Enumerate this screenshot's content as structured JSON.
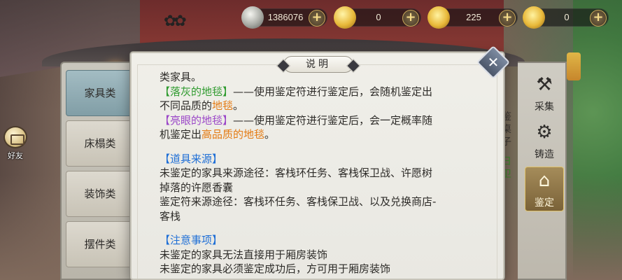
{
  "resources": [
    {
      "icon": "silver-coin-icon",
      "value": "1386076"
    },
    {
      "icon": "gold-coin-icon",
      "value": "0"
    },
    {
      "icon": "gold-ingot-icon",
      "value": "225"
    },
    {
      "icon": "gold-ingot-stack-icon",
      "value": "0"
    }
  ],
  "friends": {
    "label": "好友"
  },
  "categories": [
    {
      "label": "家具类",
      "active": true
    },
    {
      "label": "床榻类",
      "active": false
    },
    {
      "label": "装饰类",
      "active": false
    },
    {
      "label": "摆件类",
      "active": false
    }
  ],
  "actions": [
    {
      "label": "采集",
      "icon": "pickaxe-icon",
      "glyph": "⚒"
    },
    {
      "label": "铸造",
      "icon": "anvil-icon",
      "glyph": "⚙"
    },
    {
      "label": "鉴定",
      "icon": "appraise-icon",
      "glyph": "⌂"
    }
  ],
  "side_text": "鉴桌子",
  "side_text_green": "日卫",
  "scene": {
    "sign_text": "铸造"
  },
  "dialog": {
    "title": "说明",
    "close_symbol": "✕",
    "lines": [
      {
        "segments": [
          {
            "text": "类家具。",
            "color": "default"
          }
        ]
      },
      {
        "segments": [
          {
            "text": "【落灰的地毯】",
            "color": "green"
          },
          {
            "text": "——使用鉴定符进行鉴定后，会随机鉴定出",
            "color": "default"
          }
        ]
      },
      {
        "segments": [
          {
            "text": "不同品质的",
            "color": "default"
          },
          {
            "text": "地毯",
            "color": "orange"
          },
          {
            "text": "。",
            "color": "default"
          }
        ]
      },
      {
        "segments": [
          {
            "text": "【亮眼的地毯】",
            "color": "purple"
          },
          {
            "text": "——使用鉴定符进行鉴定后，会一定概率随",
            "color": "default"
          }
        ]
      },
      {
        "segments": [
          {
            "text": "机鉴定出",
            "color": "default"
          },
          {
            "text": "高品质的地毯",
            "color": "orange"
          },
          {
            "text": "。",
            "color": "default"
          }
        ]
      },
      {
        "gap": true
      },
      {
        "segments": [
          {
            "text": "【道具来源】",
            "color": "blue"
          }
        ]
      },
      {
        "segments": [
          {
            "text": "未鉴定的家具来源途径：客栈环任务、客栈保卫战、许愿树",
            "color": "default"
          }
        ]
      },
      {
        "segments": [
          {
            "text": "掉落的许愿香囊",
            "color": "default"
          }
        ]
      },
      {
        "segments": [
          {
            "text": "鉴定符来源途径：客栈环任务、客栈保卫战、以及兑换商店-",
            "color": "default"
          }
        ]
      },
      {
        "segments": [
          {
            "text": "客栈",
            "color": "default"
          }
        ]
      },
      {
        "gap": true
      },
      {
        "segments": [
          {
            "text": "【注意事项】",
            "color": "blue"
          }
        ]
      },
      {
        "segments": [
          {
            "text": "未鉴定的家具无法直接用于厢房装饰",
            "color": "default"
          }
        ]
      },
      {
        "segments": [
          {
            "text": "未鉴定的家具必须鉴定成功后，方可用于厢房装饰",
            "color": "default"
          }
        ]
      }
    ]
  },
  "colors": {
    "green": "#2f9b2f",
    "purple": "#9b47c8",
    "orange": "#e47a12",
    "blue": "#1f6fd6",
    "default": "#2d2b28"
  }
}
